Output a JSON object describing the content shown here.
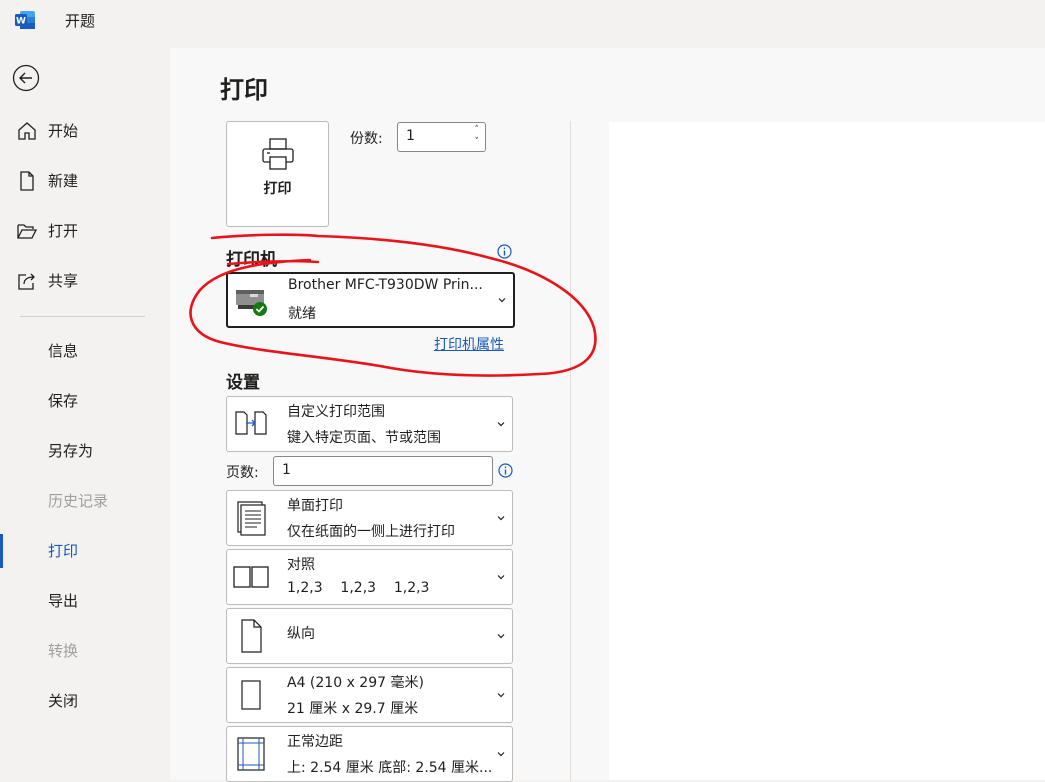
{
  "app": {
    "title": "开题",
    "logo_icon": "word-logo-icon",
    "accent": "#185abd"
  },
  "nav": {
    "back_icon": "back-arrow-icon",
    "items": [
      {
        "label": "开始",
        "icon": "home-icon"
      },
      {
        "label": "新建",
        "icon": "new-document-icon"
      },
      {
        "label": "打开",
        "icon": "folder-open-icon"
      },
      {
        "label": "共享",
        "icon": "share-icon"
      },
      {
        "label": "信息"
      },
      {
        "label": "保存"
      },
      {
        "label": "另存为"
      },
      {
        "label": "历史记录",
        "disabled": true
      },
      {
        "label": "打印",
        "active": true
      },
      {
        "label": "导出"
      },
      {
        "label": "转换",
        "disabled": true
      },
      {
        "label": "关闭"
      }
    ]
  },
  "print": {
    "heading": "打印",
    "print_button_label": "打印",
    "copies_label": "份数:",
    "copies_value": "1",
    "printer_section": "打印机",
    "printer": {
      "name": "Brother MFC-T930DW Prin...",
      "status": "就绪",
      "status_color": "#107c10"
    },
    "printer_properties_link": "打印机属性",
    "settings_section": "设置",
    "settings": {
      "range": {
        "title": "自定义打印范围",
        "desc": "键入特定页面、节或范围"
      },
      "pages_label": "页数:",
      "pages_value": "1",
      "sides": {
        "title": "单面打印",
        "desc": "仅在纸面的一侧上进行打印"
      },
      "collate": {
        "title": "对照",
        "desc": "1,2,3    1,2,3    1,2,3"
      },
      "orientation": {
        "title": "纵向"
      },
      "paper": {
        "title": "A4 (210 x 297 毫米)",
        "desc": "21 厘米 x 29.7 厘米"
      },
      "margins": {
        "title": "正常边距",
        "desc": "上: 2.54 厘米 底部: 2.54 厘米..."
      }
    }
  },
  "annotation": {
    "color": "#e8131b",
    "shape": "freehand-ellipse"
  }
}
